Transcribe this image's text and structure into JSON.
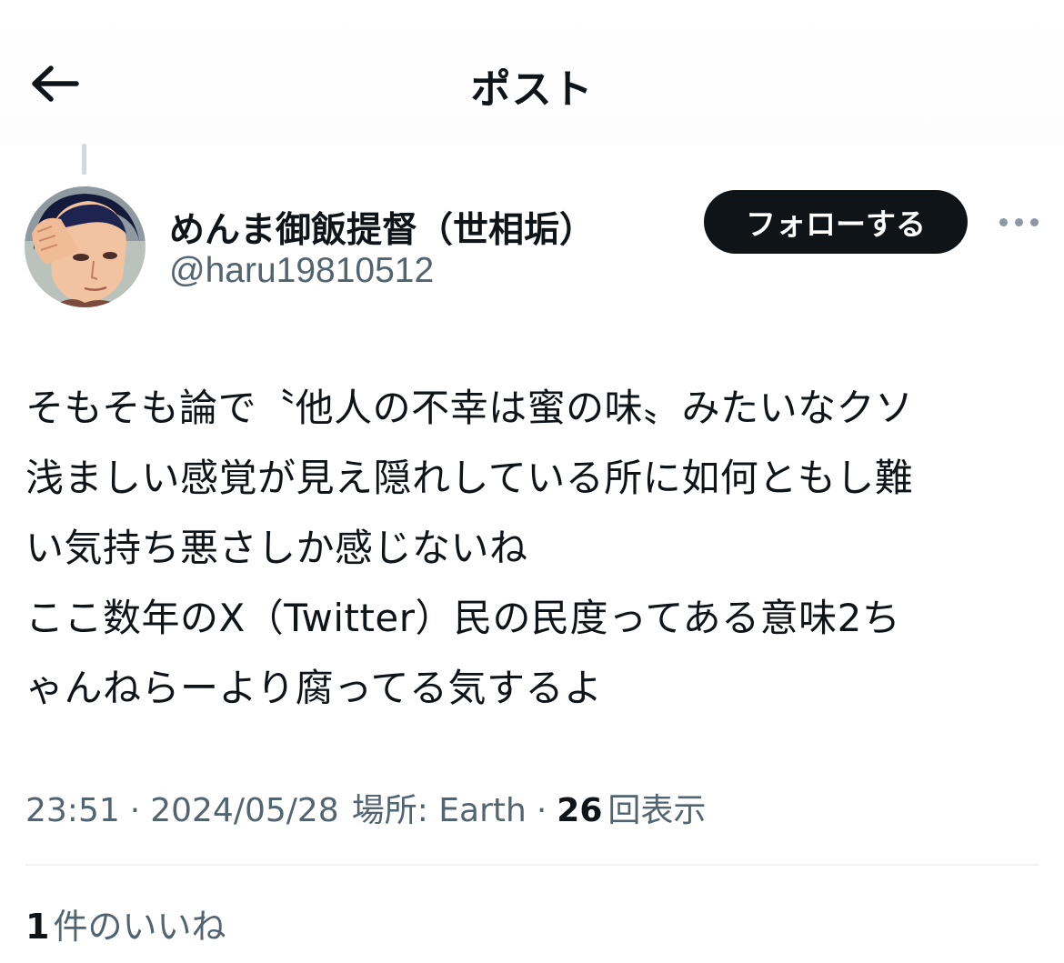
{
  "header": {
    "title": "ポスト",
    "back_icon": "arrow-left-icon"
  },
  "author": {
    "display_name": "めんま御飯提督（世相垢）",
    "handle": "@haru19810512",
    "follow_label": "フォローする",
    "more_icon": "more-horizontal-icon"
  },
  "tweet": {
    "lines": [
      "そもそも論で〝他人の不幸は蜜の味〟みたいなクソ",
      "浅ましい感覚が見え隠れしている所に如何ともし難",
      "い気持ち悪さしか感じないね",
      "ここ数年のX（Twitter）民の民度ってある意味2ち",
      "ゃんねらーより腐ってる気するよ"
    ]
  },
  "meta": {
    "time": "23:51",
    "separator": "·",
    "date": "2024/05/28",
    "location": "場所: Earth",
    "views_count": "26",
    "views_label": "回表示"
  },
  "likes": {
    "count": "1",
    "label": "件のいいね"
  },
  "colors": {
    "text_primary": "#0f1419",
    "text_secondary": "#536471",
    "button_bg": "#0f1419",
    "divider": "#eff3f4"
  }
}
